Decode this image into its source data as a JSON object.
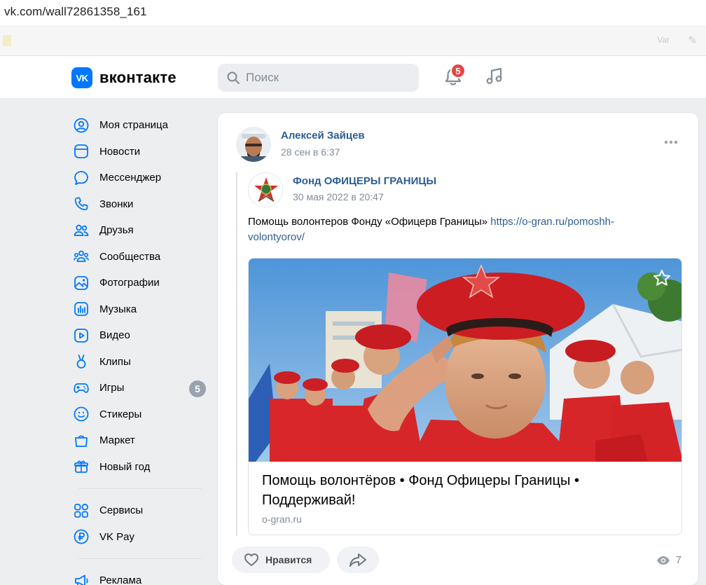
{
  "browser": {
    "url": "vk.com/wall72861358_161",
    "bookmark_faint_1": "Var"
  },
  "header": {
    "logo_badge": "VK",
    "logo_text": "вконтакте",
    "search_placeholder": "Поиск",
    "notifications_count": "5"
  },
  "sidebar": {
    "items": [
      {
        "label": "Моя страница",
        "icon": "user-circle-icon"
      },
      {
        "label": "Новости",
        "icon": "news-icon"
      },
      {
        "label": "Мессенджер",
        "icon": "message-icon"
      },
      {
        "label": "Звонки",
        "icon": "phone-icon"
      },
      {
        "label": "Друзья",
        "icon": "friends-icon"
      },
      {
        "label": "Сообщества",
        "icon": "communities-icon"
      },
      {
        "label": "Фотографии",
        "icon": "photos-icon"
      },
      {
        "label": "Музыка",
        "icon": "music-icon"
      },
      {
        "label": "Видео",
        "icon": "video-icon"
      },
      {
        "label": "Клипы",
        "icon": "clips-icon"
      },
      {
        "label": "Игры",
        "icon": "games-icon",
        "count": "5"
      },
      {
        "label": "Стикеры",
        "icon": "stickers-icon"
      },
      {
        "label": "Маркет",
        "icon": "market-icon"
      },
      {
        "label": "Новый год",
        "icon": "gift-icon"
      }
    ],
    "items2": [
      {
        "label": "Сервисы",
        "icon": "services-icon"
      },
      {
        "label": "VK Pay",
        "icon": "vkpay-icon"
      }
    ],
    "items3": [
      {
        "label": "Реклама",
        "icon": "megaphone-icon"
      }
    ]
  },
  "post": {
    "author_name": "Алексей Зайцев",
    "author_date": "28 сен в 6:37",
    "repost": {
      "group_name": "Фонд ОФИЦЕРЫ ГРАНИЦЫ",
      "group_date": "30 мая 2022 в 20:47",
      "text": "Помощь волонтеров Фонду «Офицерв Границы» ",
      "link_text": "https://o-gran.ru/pomoshh-volontyorov/"
    },
    "attachment": {
      "title": "Помощь волонтёров • Фонд Офицеры Границы • Поддерживай!",
      "domain": "o-gran.ru"
    },
    "like_label": "Нравится",
    "views": "7"
  },
  "colors": {
    "accent": "#0077ff",
    "link": "#2c5d93",
    "badge_red": "#e64646",
    "beret_red": "#d42a2a"
  }
}
